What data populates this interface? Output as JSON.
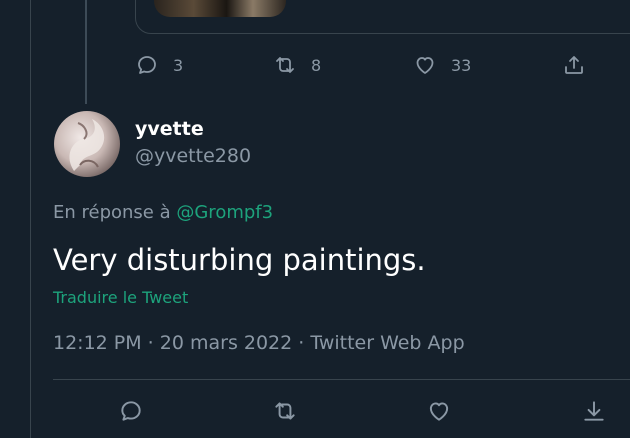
{
  "previous_tweet": {
    "actions": {
      "reply_count": "3",
      "retweet_count": "8",
      "like_count": "33"
    }
  },
  "tweet": {
    "display_name": "yvette",
    "handle": "@yvette280",
    "reply_prefix": "En réponse à ",
    "reply_to": "@Grompf3",
    "text": "Very disturbing paintings.",
    "translate_label": "Traduire le Tweet",
    "meta": "12:12 PM · 20 mars 2022 · Twitter Web App"
  },
  "colors": {
    "background": "#15202b",
    "link_accent": "#1da37c",
    "secondary_text": "#8b98a5",
    "border": "#38444d"
  },
  "icons": {
    "reply": "speech-bubble-icon",
    "retweet": "retweet-icon",
    "like": "heart-icon",
    "share": "share-icon",
    "bookmark": "bookmark-download-icon"
  }
}
